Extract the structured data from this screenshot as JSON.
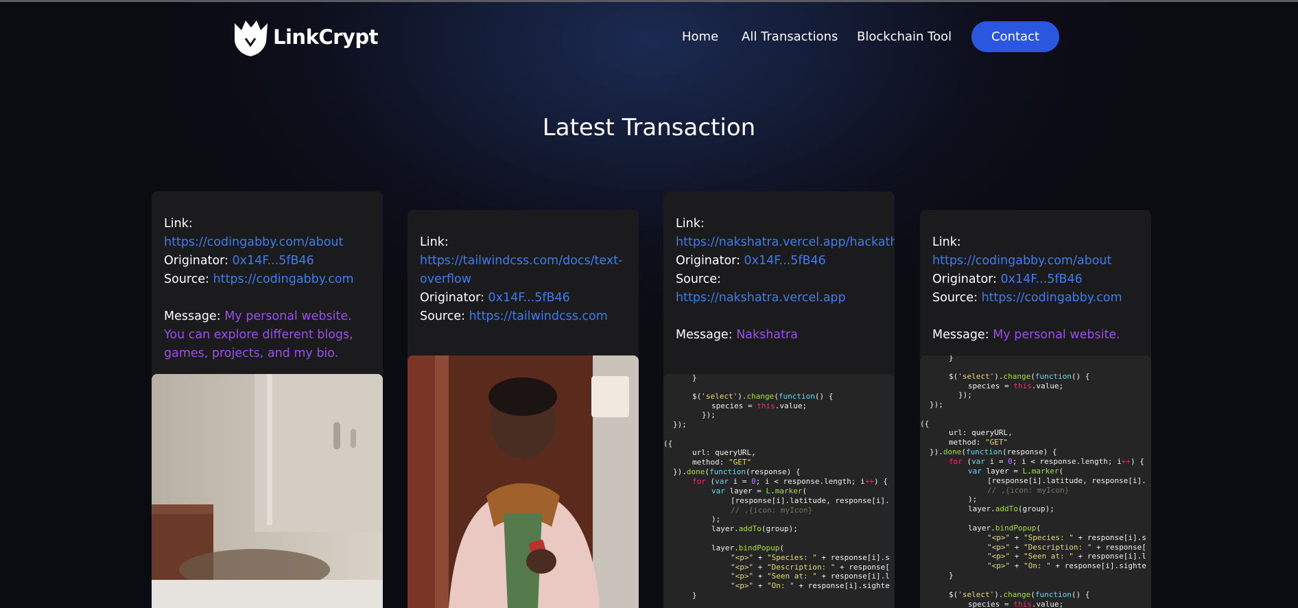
{
  "nav": {
    "brand": "LinkCrypt",
    "links": [
      "Home",
      "All Transactions",
      "Blockchain Tool"
    ],
    "contact_label": "Contact"
  },
  "page": {
    "title": "Latest Transaction"
  },
  "labels": {
    "link": "Link:",
    "originator": "Originator:",
    "source": "Source:",
    "message": "Message:"
  },
  "cards": [
    {
      "link": "https://codingabby.com/about",
      "originator": "0x14F...5fB46",
      "source": "https://codingabby.com",
      "message": "My personal website. You can explore different blogs, games, projects, and my bio."
    },
    {
      "link_line1": "https://tailwindcss.com/docs/text-",
      "link_line2": "overflow",
      "originator": "0x14F...5fB46",
      "source": "https://tailwindcss.com"
    },
    {
      "link": "https://nakshatra.vercel.app/hackathon",
      "originator": "0x14F...5fB46",
      "source": "https://nakshatra.vercel.app",
      "message": "Nakshatra"
    },
    {
      "link": "https://codingabby.com/about",
      "originator": "0x14F...5fB46",
      "source": "https://codingabby.com",
      "message": "My personal website."
    }
  ],
  "colors": {
    "accent": "#2b57e0",
    "link": "#3b7cf0",
    "message": "#9b4df0",
    "card": "#1b1b1e"
  },
  "icons": {
    "logo": "shield-wolf-logo-icon"
  }
}
